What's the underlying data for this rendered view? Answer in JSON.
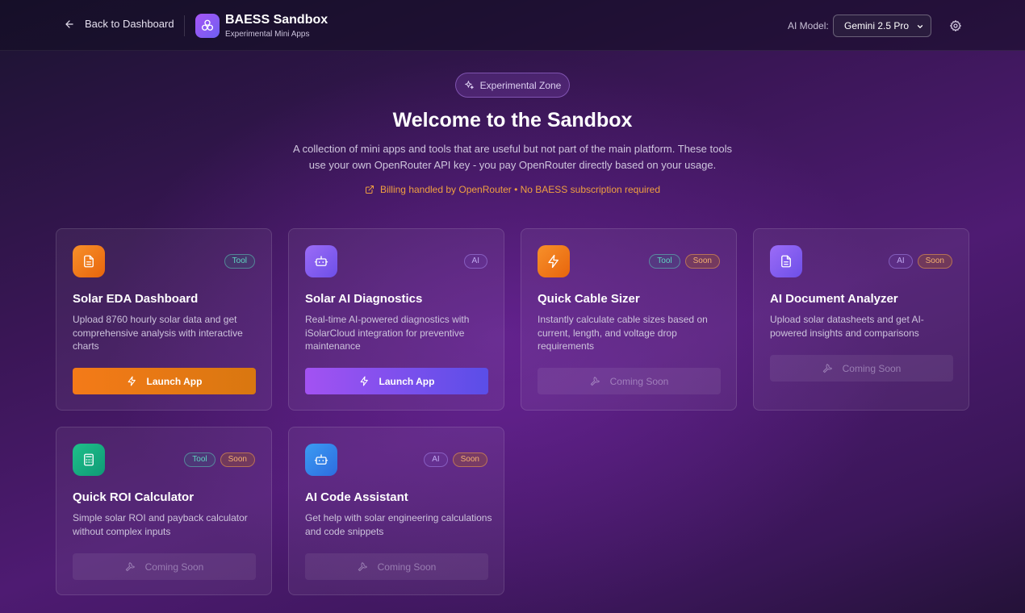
{
  "header": {
    "back_label": "Back to Dashboard",
    "brand_title": "BAESS Sandbox",
    "brand_subtitle": "Experimental Mini Apps",
    "model_label": "AI Model:",
    "model_value": "Gemini 2.5 Pro"
  },
  "hero": {
    "badge": "Experimental Zone",
    "title": "Welcome to the Sandbox",
    "description": "A collection of mini apps and tools that are useful but not part of the main platform. These tools use your own OpenRouter API key - you pay OpenRouter directly based on your usage.",
    "billing_note": "Billing handled by OpenRouter • No BAESS subscription required"
  },
  "cards": [
    {
      "title": "Solar EDA Dashboard",
      "description": "Upload 8760 hourly solar data and get comprehensive analysis with interactive charts",
      "icon": "document-icon",
      "icon_color": "#f47a18",
      "tags": [
        "Tool"
      ],
      "button_label": "Launch App"
    },
    {
      "title": "Solar AI Diagnostics",
      "description": "Real-time AI-powered diagnostics with iSolarCloud integration for preventive maintenance",
      "icon": "bot-icon",
      "icon_color": "#8b5cf6",
      "tags": [
        "AI"
      ],
      "button_label": "Launch App"
    },
    {
      "title": "Quick Cable Sizer",
      "description": "Instantly calculate cable sizes based on current, length, and voltage drop requirements",
      "icon": "zap-icon",
      "icon_color": "#f47a18",
      "tags": [
        "Tool",
        "Soon"
      ],
      "button_label": "Coming Soon"
    },
    {
      "title": "AI Document Analyzer",
      "description": "Upload solar datasheets and get AI-powered insights and comparisons",
      "icon": "document-icon",
      "icon_color": "#8b5cf6",
      "tags": [
        "AI",
        "Soon"
      ],
      "button_label": "Coming Soon"
    },
    {
      "title": "Quick ROI Calculator",
      "description": "Simple solar ROI and payback calculator without complex inputs",
      "icon": "calculator-icon",
      "icon_color": "#10b981",
      "tags": [
        "Tool",
        "Soon"
      ],
      "button_label": "Coming Soon"
    },
    {
      "title": "AI Code Assistant",
      "description": "Get help with solar engineering calculations and code snippets",
      "icon": "bot-icon",
      "icon_color": "#3b82f6",
      "tags": [
        "AI",
        "Soon"
      ],
      "button_label": "Coming Soon"
    }
  ]
}
